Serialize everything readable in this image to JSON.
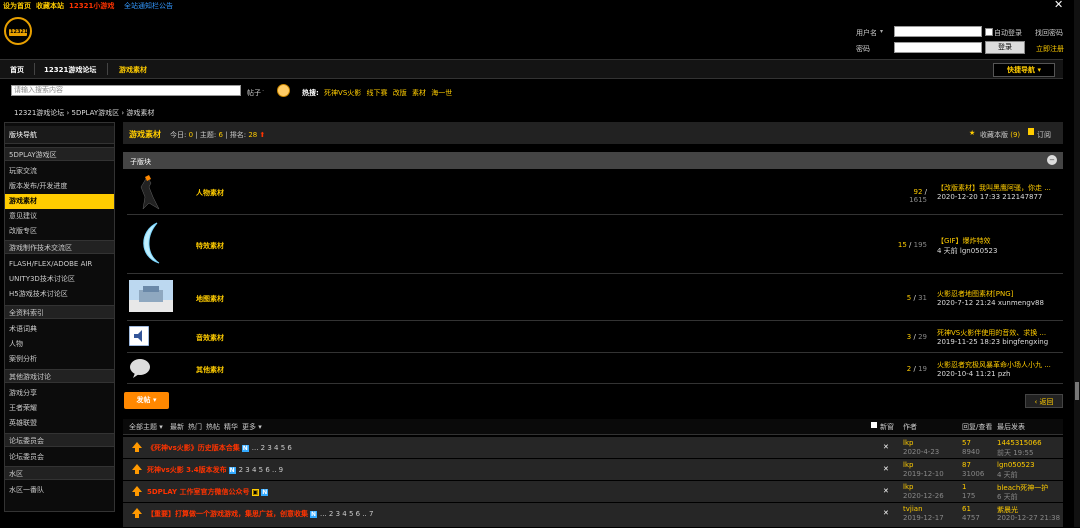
{
  "topbar": {
    "set_home": "设为首页",
    "bookmark": "收藏本站",
    "mini_game": "12321小游戏",
    "notice": "全站通知栏公告"
  },
  "logo": {
    "text": "12321"
  },
  "login": {
    "username_label": "用户名",
    "password_label": "密码",
    "auto_login": "自动登录",
    "find_password": "找回密码",
    "login_button": "登录",
    "register": "立即注册"
  },
  "nav": {
    "home": "首页",
    "forum": "12321游戏论坛",
    "current": "游戏素材",
    "quick_nav": "快捷导航"
  },
  "search": {
    "placeholder": "请输入搜索内容",
    "type_label": "帖子",
    "hot_label": "热搜:",
    "hot": [
      "死神VS火影",
      "线下赛",
      "改版",
      "素材",
      "海一世"
    ]
  },
  "breadcrumb": {
    "text": "12321游戏论坛  ›  5DPLAY游戏区  ›  游戏素材"
  },
  "sidebar": {
    "title": "版块导航",
    "groups": [
      {
        "name": "5DPLAY游戏区",
        "items": [
          "玩家交流",
          "版本发布/开发进度",
          "游戏素材",
          "意见建议",
          "改版专区"
        ]
      },
      {
        "name": "游戏制作技术交流区",
        "items": [
          "FLASH/FLEX/ADOBE AIR",
          "UNITY3D技术讨论区",
          "H5游戏技术讨论区"
        ]
      },
      {
        "name": "全资料索引",
        "items": [
          "术语词典",
          "人物",
          "案例分析"
        ]
      },
      {
        "name": "其他游戏讨论",
        "items": [
          "游戏分享",
          "王者荣耀",
          "英雄联盟"
        ]
      },
      {
        "name": "论坛委员会",
        "items": [
          "论坛委员会"
        ]
      },
      {
        "name": "水区",
        "items": [
          "水区一番队"
        ]
      }
    ]
  },
  "forum_header": {
    "title": "游戏素材",
    "today_label": "今日:",
    "today": "0",
    "topics_label": "主题:",
    "topics": "6",
    "rank_label": "排名:",
    "rank": "28",
    "favorite": "收藏本版",
    "favorite_count": "(9)",
    "subscribe": "订阅"
  },
  "subforums": {
    "title": "子版块",
    "items": [
      {
        "name": "人物素材",
        "topics": "92",
        "posts": "1615",
        "last_title": "【改版素材】我叫黑鹰阿骚，你走 ...",
        "last_info": "2020-12-20 17:33 212147877"
      },
      {
        "name": "特效素材",
        "topics": "15",
        "posts": "195",
        "last_title": "【GIF】爆炸特效",
        "last_info": "4 天前 lgn050523"
      },
      {
        "name": "地图素材",
        "topics": "5",
        "posts": "31",
        "last_title": "火影忍者地图素材[PNG]",
        "last_info": "2020-7-12 21:24 xunmengv88"
      },
      {
        "name": "音效素材",
        "topics": "3",
        "posts": "29",
        "last_title": "死神VS火影伴使用的音效、求换 ...",
        "last_info": "2019-11-25 18:23 bingfengxing"
      },
      {
        "name": "其他素材",
        "topics": "2",
        "posts": "19",
        "last_title": "火影忍者究极风暴革命小场人小九 ...",
        "last_info": "2020-10-4 11:21 pzh"
      }
    ]
  },
  "actions": {
    "post": "发帖",
    "back": "返回"
  },
  "thread_tabs": {
    "all": "全部主题",
    "latest": "最新",
    "hot": "热门",
    "heat": "热帖",
    "digest": "精华",
    "more": "更多",
    "new_window": "新窗",
    "author": "作者",
    "replies_views": "回复/查看",
    "last_post": "最后发表"
  },
  "threads": [
    {
      "title": "《死神vs火影》历史版本合集",
      "pages": "... 2 3 4 5 6",
      "author": "lkp",
      "date": "2020-4-23",
      "replies": "57",
      "views": "8940",
      "last_user": "1445315066",
      "last_time": "前天 19:55"
    },
    {
      "title": "死神vs火影 3.4版本发布",
      "pages": "2 3 4 5 6 .. 9",
      "author": "lkp",
      "date": "2019-12-10",
      "replies": "87",
      "views": "31006",
      "last_user": "lgn050523",
      "last_time": "4 天前"
    },
    {
      "title": "5DPLAY 工作室官方微信公众号",
      "pages": "",
      "author": "lkp",
      "date": "2020-12-26",
      "replies": "1",
      "views": "175",
      "last_user": "bleach死神一护",
      "last_time": "6 天前"
    },
    {
      "title": "【重要】打算做一个游戏游戏，集思广益，创意收集",
      "pages": "... 2 3 4 5 6 .. 7",
      "author": "tvjian",
      "date": "2019-12-17",
      "replies": "61",
      "views": "4757",
      "last_user": "紫晨光",
      "last_time": "2020-12-27 21:38"
    }
  ],
  "colors": {
    "accent": "#ffcc00",
    "title_red": "#ff3300",
    "post_button": "#ff8800"
  }
}
